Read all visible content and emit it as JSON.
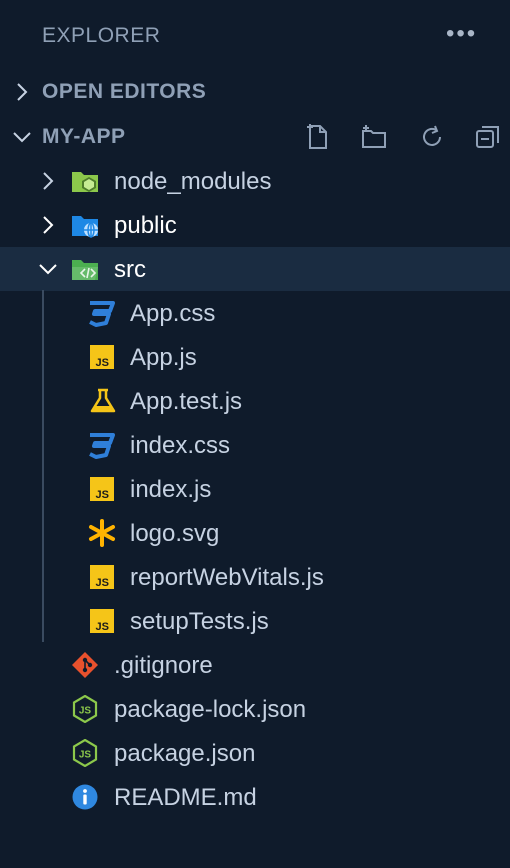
{
  "header": {
    "title": "EXPLORER",
    "more_icon": "ellipsis-icon"
  },
  "sections": {
    "open_editors": {
      "label": "OPEN EDITORS",
      "expanded": false
    },
    "project": {
      "label": "MY-APP",
      "expanded": true,
      "actions": [
        "new-file-icon",
        "new-folder-icon",
        "refresh-icon",
        "collapse-all-icon"
      ]
    }
  },
  "tree": {
    "node_modules": {
      "name": "node_modules",
      "icon": "node-modules-folder-icon"
    },
    "public": {
      "name": "public",
      "icon": "public-folder-icon"
    },
    "src": {
      "name": "src",
      "icon": "src-folder-icon",
      "selected": true
    },
    "src_files": [
      {
        "name": "App.css",
        "icon": "css-icon"
      },
      {
        "name": "App.js",
        "icon": "js-icon"
      },
      {
        "name": "App.test.js",
        "icon": "test-flask-icon"
      },
      {
        "name": "index.css",
        "icon": "css-icon"
      },
      {
        "name": "index.js",
        "icon": "js-icon"
      },
      {
        "name": "logo.svg",
        "icon": "svg-asterisk-icon"
      },
      {
        "name": "reportWebVitals.js",
        "icon": "js-icon"
      },
      {
        "name": "setupTests.js",
        "icon": "js-icon"
      }
    ],
    "root_files": [
      {
        "name": ".gitignore",
        "icon": "git-icon"
      },
      {
        "name": "package-lock.json",
        "icon": "nodejs-icon"
      },
      {
        "name": "package.json",
        "icon": "nodejs-icon"
      },
      {
        "name": "README.md",
        "icon": "info-icon"
      }
    ]
  },
  "colors": {
    "background": "#0f1b2b",
    "selected_row": "#1a2c41",
    "css": "#2f7fd9",
    "js": "#f5c518",
    "node": "#8cc84b",
    "git": "#e8512d",
    "info": "#2f88e0",
    "svg": "#ffb300"
  }
}
